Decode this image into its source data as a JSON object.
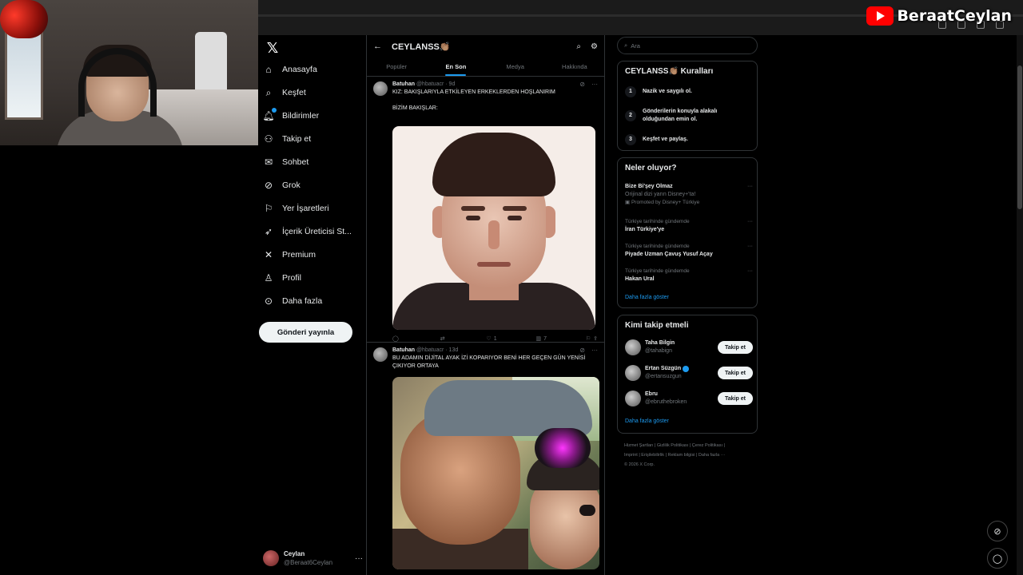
{
  "overlay": {
    "channel_name": "BeraatCeylan"
  },
  "nav": {
    "items": [
      {
        "label": "Anasayfa",
        "icon": "home-icon"
      },
      {
        "label": "Keşfet",
        "icon": "search-icon"
      },
      {
        "label": "Bildirimler",
        "icon": "bell-icon"
      },
      {
        "label": "Takip et",
        "icon": "person-add-icon"
      },
      {
        "label": "Sohbet",
        "icon": "mail-icon"
      },
      {
        "label": "Grok",
        "icon": "grok-icon"
      },
      {
        "label": "Yer İşaretleri",
        "icon": "bookmark-icon"
      },
      {
        "label": "İçerik Üreticisi St...",
        "icon": "rocket-icon"
      },
      {
        "label": "Premium",
        "icon": "x-icon"
      },
      {
        "label": "Profil",
        "icon": "person-icon"
      },
      {
        "label": "Daha fazla",
        "icon": "more-circle-icon"
      }
    ],
    "post_button": "Gönderi yayınla",
    "account": {
      "name": "Ceylan",
      "handle": "@Beraat6Ceylan"
    }
  },
  "community": {
    "title": "CEYLANSS👏🏽",
    "tabs": [
      "Popüler",
      "En Son",
      "Medya",
      "Hakkında"
    ],
    "active_tab": "En Son"
  },
  "tweets": [
    {
      "author": "Batuhan",
      "handle": "@hbatuacr",
      "time": "9d",
      "text_lines": [
        "KIZ: BAKIŞLARIYLA ETKİLEYEN ERKEKLERDEN HOŞLANIRIM",
        "",
        "BİZİM BAKIŞLAR:"
      ],
      "replies": "",
      "retweets": "",
      "likes": "1",
      "views": "7"
    },
    {
      "author": "Batuhan",
      "handle": "@hbatuacr",
      "time": "13d",
      "text_lines": [
        "BU ADAMIN DİJİTAL AYAK İZİ KOPARIYOR BENİ HER GEÇEN GÜN YENİSİ",
        "ÇIKIYOR ORTAYA"
      ]
    }
  ],
  "sidebar": {
    "search_placeholder": "Ara",
    "rules": {
      "title": "CEYLANSS👏🏽 Kuralları",
      "items": [
        {
          "num": "1",
          "text": "Nazik ve saygılı ol."
        },
        {
          "num": "2",
          "text": "Gönderilerin konuyla alakalı olduğundan emin ol."
        },
        {
          "num": "3",
          "text": "Keşfet ve paylaş."
        }
      ]
    },
    "trends": {
      "title": "Neler oluyor?",
      "items": [
        {
          "context": "",
          "title": "Bize Bi'şey Olmaz",
          "sub": "Orijinal dizi yarın Disney+'ta!",
          "promo": "Promoted by Disney+ Türkiye"
        },
        {
          "context": "Türkiye tarihinde gündemde",
          "title": "İran Türkiye'ye"
        },
        {
          "context": "Türkiye tarihinde gündemde",
          "title": "Piyade Uzman Çavuş Yusuf Açay"
        },
        {
          "context": "Türkiye tarihinde gündemde",
          "title": "Hakan Ural"
        }
      ],
      "show_more": "Daha fazla göster"
    },
    "who_to_follow": {
      "title": "Kimi takip etmeli",
      "items": [
        {
          "name": "Taha Bilgin",
          "handle": "@tahabign",
          "verified": false,
          "button": "Takip et"
        },
        {
          "name": "Ertan Süzgün",
          "handle": "@ertansuzgun",
          "verified": true,
          "button": "Takip et"
        },
        {
          "name": "Ebru",
          "handle": "@ebruthebroken",
          "verified": false,
          "button": "Takip et"
        }
      ],
      "show_more": "Daha fazla göster"
    },
    "footer": {
      "line1": "Hizmet Şartları  |  Gizlilik Politikası  |  Çerez Politikası  |",
      "line2": "Imprint  |  Erişilebilirlik  |  Reklam bilgisi  |  Daha fazla ···",
      "line3": "© 2026 X Corp."
    }
  },
  "colors": {
    "accent": "#1d9bf0",
    "background": "#000000",
    "border": "#2f3336",
    "muted": "#71767b"
  }
}
